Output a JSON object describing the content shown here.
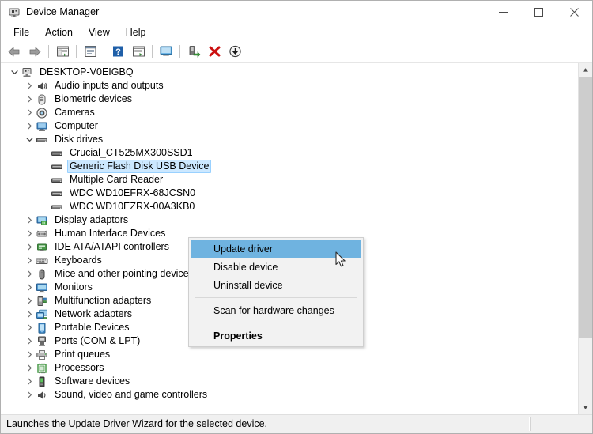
{
  "window": {
    "title": "Device Manager",
    "icon": "device-manager-icon",
    "controls": {
      "minimize": "minimize-icon",
      "maximize": "maximize-icon",
      "close": "close-icon"
    }
  },
  "menubar": {
    "items": [
      {
        "label": "File"
      },
      {
        "label": "Action"
      },
      {
        "label": "View"
      },
      {
        "label": "Help"
      }
    ]
  },
  "toolbar": {
    "buttons": [
      {
        "name": "back-icon"
      },
      {
        "name": "forward-icon"
      },
      {
        "name": "show-hide-console-tree-icon"
      },
      {
        "name": "properties-icon"
      },
      {
        "name": "help-icon"
      },
      {
        "name": "update-driver-icon"
      },
      {
        "name": "scan-for-hardware-changes-icon"
      },
      {
        "name": "enable-device-icon"
      },
      {
        "name": "uninstall-device-icon"
      },
      {
        "name": "disable-device-icon"
      }
    ]
  },
  "tree": {
    "root": {
      "label": "DESKTOP-V0EIGBQ",
      "icon": "computer-root-icon",
      "expanded": true
    },
    "nodes": [
      {
        "label": "Audio inputs and outputs",
        "icon": "audio-icon",
        "indent": 1,
        "expanded": false,
        "hasChildren": true
      },
      {
        "label": "Biometric devices",
        "icon": "biometric-icon",
        "indent": 1,
        "expanded": false,
        "hasChildren": true
      },
      {
        "label": "Cameras",
        "icon": "camera-icon",
        "indent": 1,
        "expanded": false,
        "hasChildren": true
      },
      {
        "label": "Computer",
        "icon": "computer-icon",
        "indent": 1,
        "expanded": false,
        "hasChildren": true
      },
      {
        "label": "Disk drives",
        "icon": "disk-drive-icon",
        "indent": 1,
        "expanded": true,
        "hasChildren": true
      },
      {
        "label": "Crucial_CT525MX300SSD1",
        "icon": "disk-drive-icon",
        "indent": 2,
        "hasChildren": false
      },
      {
        "label": "Generic Flash Disk USB Device",
        "icon": "disk-drive-icon",
        "indent": 2,
        "hasChildren": false,
        "selected": true
      },
      {
        "label": "Multiple Card Reader",
        "icon": "disk-drive-icon",
        "indent": 2,
        "hasChildren": false
      },
      {
        "label": "WDC WD10EFRX-68JCSN0",
        "icon": "disk-drive-icon",
        "indent": 2,
        "hasChildren": false
      },
      {
        "label": "WDC WD10EZRX-00A3KB0",
        "icon": "disk-drive-icon",
        "indent": 2,
        "hasChildren": false
      },
      {
        "label": "Display adaptors",
        "icon": "display-adapter-icon",
        "indent": 1,
        "expanded": false,
        "hasChildren": true
      },
      {
        "label": "Human Interface Devices",
        "icon": "hid-icon",
        "indent": 1,
        "expanded": false,
        "hasChildren": true
      },
      {
        "label": "IDE ATA/ATAPI controllers",
        "icon": "ide-controller-icon",
        "indent": 1,
        "expanded": false,
        "hasChildren": true
      },
      {
        "label": "Keyboards",
        "icon": "keyboard-icon",
        "indent": 1,
        "expanded": false,
        "hasChildren": true
      },
      {
        "label": "Mice and other pointing devices",
        "icon": "mouse-icon",
        "indent": 1,
        "expanded": false,
        "hasChildren": true
      },
      {
        "label": "Monitors",
        "icon": "monitor-icon",
        "indent": 1,
        "expanded": false,
        "hasChildren": true
      },
      {
        "label": "Multifunction adapters",
        "icon": "multifunction-adapter-icon",
        "indent": 1,
        "expanded": false,
        "hasChildren": true
      },
      {
        "label": "Network adapters",
        "icon": "network-adapter-icon",
        "indent": 1,
        "expanded": false,
        "hasChildren": true
      },
      {
        "label": "Portable Devices",
        "icon": "portable-device-icon",
        "indent": 1,
        "expanded": false,
        "hasChildren": true
      },
      {
        "label": "Ports (COM & LPT)",
        "icon": "port-icon",
        "indent": 1,
        "expanded": false,
        "hasChildren": true
      },
      {
        "label": "Print queues",
        "icon": "printer-icon",
        "indent": 1,
        "expanded": false,
        "hasChildren": true
      },
      {
        "label": "Processors",
        "icon": "processor-icon",
        "indent": 1,
        "expanded": false,
        "hasChildren": true
      },
      {
        "label": "Software devices",
        "icon": "software-device-icon",
        "indent": 1,
        "expanded": false,
        "hasChildren": true
      },
      {
        "label": "Sound, video and game controllers",
        "icon": "sound-icon",
        "indent": 1,
        "expanded": false,
        "hasChildren": true
      }
    ]
  },
  "context_menu": {
    "items": [
      {
        "label": "Update driver",
        "highlighted": true,
        "bold": false
      },
      {
        "label": "Disable device",
        "highlighted": false,
        "bold": false
      },
      {
        "label": "Uninstall device",
        "highlighted": false,
        "bold": false
      },
      {
        "separator": true
      },
      {
        "label": "Scan for hardware changes",
        "highlighted": false,
        "bold": false
      },
      {
        "separator": true
      },
      {
        "label": "Properties",
        "highlighted": false,
        "bold": true
      }
    ]
  },
  "statusbar": {
    "message": "Launches the Update Driver Wizard for the selected device.",
    "second_panel": ""
  },
  "colors": {
    "selection_blue": "#cce8ff",
    "menu_highlight_blue": "#6fb3e0",
    "window_bg": "#f0f0f0",
    "pane_bg": "#ffffff"
  }
}
